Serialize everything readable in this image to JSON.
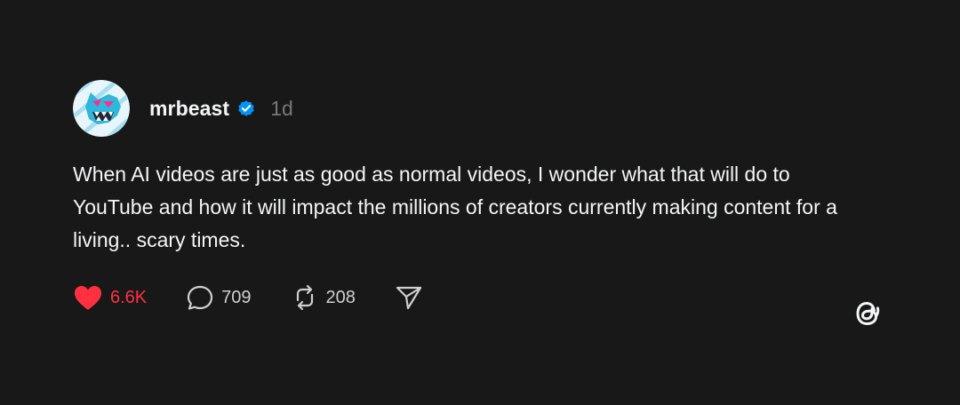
{
  "post": {
    "username": "mrbeast",
    "verified": true,
    "time": "1d",
    "text": "When AI videos are just as good as normal videos, I wonder what that will do to YouTube and how it will impact the millions of creators currently making content for a living.. scary times."
  },
  "actions": {
    "likes": "6.6K",
    "comments": "709",
    "reposts": "208"
  },
  "icons": {
    "avatar": "mrbeast-panther-avatar",
    "verified": "verified-badge-icon",
    "like": "heart-icon",
    "comment": "comment-bubble-icon",
    "repost": "repost-icon",
    "share": "send-icon",
    "brand": "threads-logo-icon"
  },
  "colors": {
    "background": "#181818",
    "text": "#f3f5f7",
    "muted": "#777777",
    "like": "#ff3040",
    "verified": "#0095f6"
  }
}
